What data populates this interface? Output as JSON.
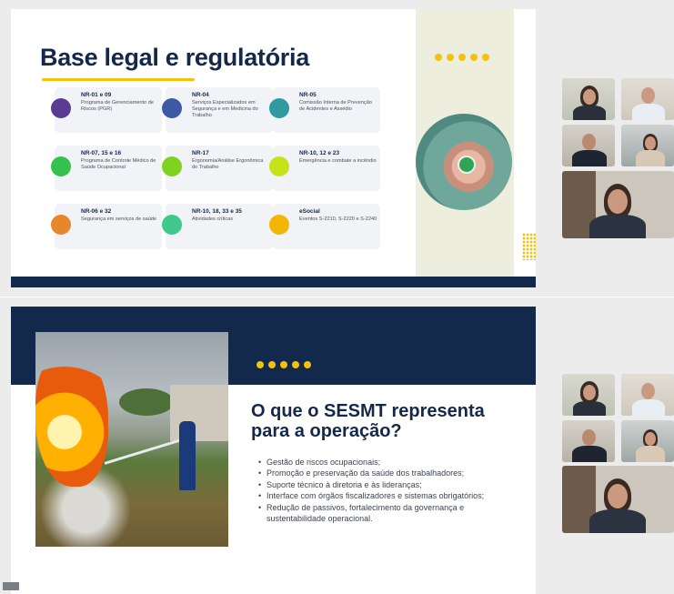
{
  "slide1": {
    "title": "Base legal e regulatória",
    "cards": [
      {
        "title": "NR-01 e 09",
        "desc": "Programa de Gerenciamento de Riscos (PGR)",
        "color": "#5a3c93"
      },
      {
        "title": "NR-04",
        "desc": "Serviços Especializados em Segurança e em Medicina do Trabalho",
        "color": "#3d59a6"
      },
      {
        "title": "NR-05",
        "desc": "Comissão Interna de Prevenção de Acidentes e Assédio",
        "color": "#2f9aa0"
      },
      {
        "title": "NR-07, 15 e 16",
        "desc": "Programa de Controle Médico de Saúde Ocupacional",
        "color": "#33c24d"
      },
      {
        "title": "NR-17",
        "desc": "Ergonomia/Análise Ergonômica do Trabalho",
        "color": "#7ed321"
      },
      {
        "title": "NR-10, 12 e 23",
        "desc": "Emergência e combate a incêndio",
        "color": "#c8e21a"
      },
      {
        "title": "NR-06 e 32",
        "desc": "Segurança em serviços de saúde",
        "color": "#e8872a"
      },
      {
        "title": "NR-10, 18, 33 e 35",
        "desc": "Atividades críticas",
        "color": "#3fc98a"
      },
      {
        "title": "eSocial",
        "desc": "Eventos S-2210, S-2220 e S-2240",
        "color": "#f2b705"
      }
    ]
  },
  "slide2": {
    "title": "O que o SESMT representa para a operação?",
    "bullets": [
      "Gestão de riscos ocupacionais;",
      "Promoção e preservação da saúde dos trabalhadores;",
      "Suporte técnico à diretoria e às lideranças;",
      "Interface com órgãos fiscalizadores e sistemas obrigatórios;",
      "Redução de passivos, fortalecimento da governança e sustentabilidade operacional."
    ]
  },
  "colors": {
    "navy": "#13294b",
    "accent_yellow": "#f4c20d",
    "active_speaker_border": "#7b8ce0"
  },
  "icons": [
    "fire-photo",
    "hands-circle-photo",
    "participant-video"
  ]
}
